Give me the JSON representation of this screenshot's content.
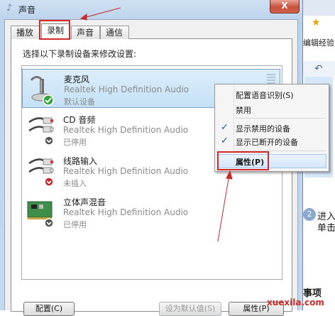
{
  "window": {
    "title": "声音",
    "close_symbol": "X"
  },
  "tabs": [
    {
      "label": "播放"
    },
    {
      "label": "录制"
    },
    {
      "label": "声音"
    },
    {
      "label": "通信"
    }
  ],
  "instruction": "选择以下录制设备来修改设置:",
  "devices": [
    {
      "name": "麦克风",
      "desc": "Realtek High Definition Audio",
      "status": "默认设备",
      "icon": "microphone-icon"
    },
    {
      "name": "CD 音频",
      "desc": "Realtek High Definition Audio",
      "status": "已停用",
      "icon": "rca-cable-icon"
    },
    {
      "name": "线路输入",
      "desc": "Realtek High Definition Audio",
      "status": "未插入",
      "icon": "rca-cable-icon"
    },
    {
      "name": "立体声混音",
      "desc": "Realtek High Definition Audio",
      "status": "已停用",
      "icon": "sound-card-icon"
    }
  ],
  "context_menu": {
    "items": [
      {
        "label": "配置语音识别(S)"
      },
      {
        "label": "禁用"
      },
      {
        "label": "显示禁用的设备",
        "checked": "✓"
      },
      {
        "label": "显示已断开的设备",
        "checked": "✓"
      },
      {
        "label": "属性(P)"
      }
    ]
  },
  "buttons": [
    {
      "label": "配置(C)"
    },
    {
      "label": "设为默认值(S)"
    },
    {
      "label": "属性(P)"
    }
  ],
  "background_app": {
    "text_top": "编辑经验",
    "step_number": "2",
    "step_line1": "进入",
    "step_line2": "单击",
    "footer_text": "事项",
    "logo": "xuexila.com"
  },
  "colors": {
    "highlight": "#d12a2a",
    "selection": "#c4e0f6",
    "check": "#1f4fa3"
  }
}
